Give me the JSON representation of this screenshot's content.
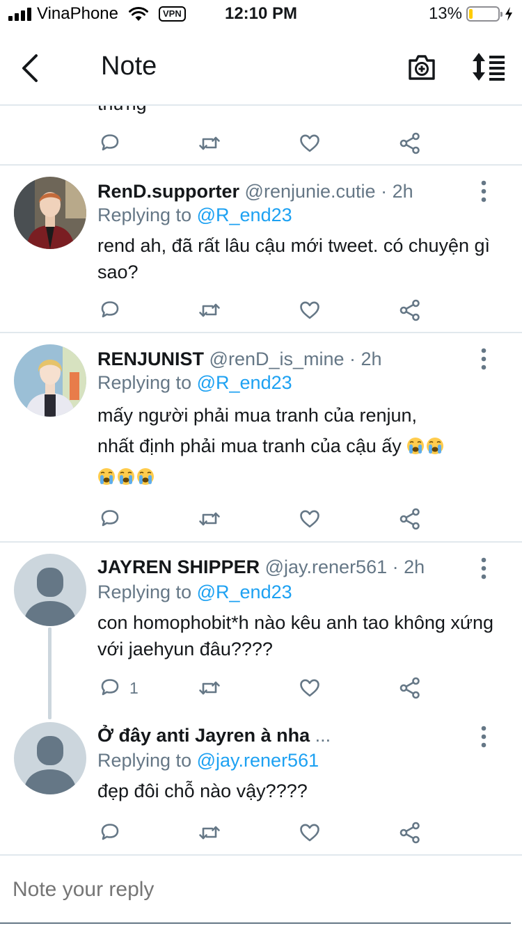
{
  "status_bar": {
    "carrier": "VinaPhone",
    "vpn": "VPN",
    "time": "12:10 PM",
    "battery": "13%",
    "battery_level": 0.13
  },
  "nav": {
    "title": "Note",
    "back_icon": "chevron-left-icon",
    "camera_icon": "camera-plus-icon",
    "sort_icon": "sort-list-icon"
  },
  "partial_tweet": {
    "text": "thứng"
  },
  "tweets": [
    {
      "name": "RenD.supporter",
      "handle": "@renjunie.cutie",
      "time": "· 2h",
      "replying_prefix": "Replying to",
      "replying_to": "@R_end23",
      "body": "rend ah, đã rất lâu cậu mới tweet. có chuyện gì sao?",
      "reply_count": ""
    },
    {
      "name": "RENJUNIST",
      "handle": "@renD_is_mine",
      "time": "· 2h",
      "replying_prefix": "Replying to",
      "replying_to": "@R_end23",
      "body_line1": "mấy người phải mua tranh của renjun,",
      "body_line2": "nhất định phải mua tranh của cậu ấy",
      "reply_count": ""
    },
    {
      "name": "JAYREN SHIPPER",
      "handle": "@jay.rener561",
      "time": "· 2h",
      "replying_prefix": "Replying to",
      "replying_to": "@R_end23",
      "body": "con homophobit*h nào kêu anh tao không xứng với jaehyun đâu????",
      "reply_count": "1"
    },
    {
      "name": "Ở đây anti Jayren à nha",
      "handle": "...",
      "time": "",
      "replying_prefix": "Replying to",
      "replying_to": "@jay.rener561",
      "body": "đẹp đôi chỗ nào vậy????",
      "reply_count": ""
    }
  ],
  "compose": {
    "placeholder": "Note your reply"
  },
  "colors": {
    "link": "#1da1f2",
    "muted": "#657786",
    "divider": "#e1e8ed",
    "icon": "#657786"
  }
}
